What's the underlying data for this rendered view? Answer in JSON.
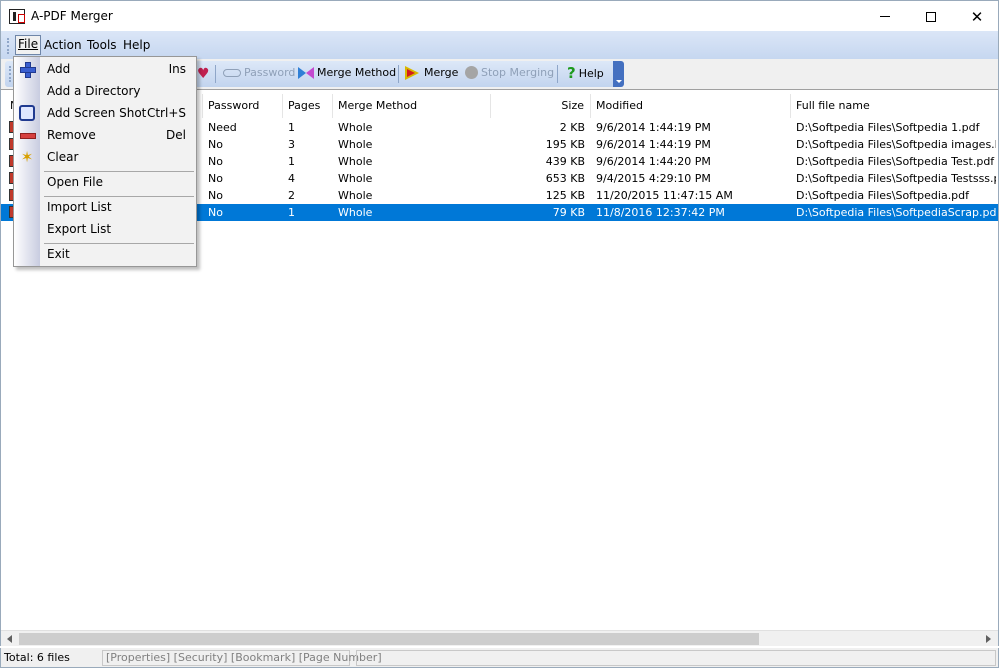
{
  "window": {
    "title": "A-PDF Merger"
  },
  "menu": {
    "items": [
      "File",
      "Action",
      "Tools",
      "Help"
    ]
  },
  "toolbar": {
    "password_label": "Password",
    "merge_method_label": "Merge Method",
    "merge_label": "Merge",
    "stop_merging_label": "Stop Merging",
    "help_label": "Help"
  },
  "file_menu": {
    "add": "Add",
    "add_shortcut": "Ins",
    "add_directory": "Add a Directory",
    "add_screenshot": "Add Screen Shot",
    "add_screenshot_shortcut": "Ctrl+S",
    "remove": "Remove",
    "remove_shortcut": "Del",
    "clear": "Clear",
    "open_file": "Open File",
    "import_list": "Import List",
    "export_list": "Export List",
    "exit": "Exit"
  },
  "list": {
    "columns": {
      "name": "N",
      "password": "Password",
      "pages": "Pages",
      "merge_method": "Merge Method",
      "size": "Size",
      "modified": "Modified",
      "full_name": "Full file name"
    },
    "rows": [
      {
        "password": "Need",
        "pages": "1",
        "method": "Whole",
        "size": "2 KB",
        "modified": "9/6/2014 1:44:19 PM",
        "path": "D:\\Softpedia Files\\Softpedia 1.pdf"
      },
      {
        "password": "No",
        "pages": "3",
        "method": "Whole",
        "size": "195 KB",
        "modified": "9/6/2014 1:44:19 PM",
        "path": "D:\\Softpedia Files\\Softpedia images.PDF"
      },
      {
        "password": "No",
        "pages": "1",
        "method": "Whole",
        "size": "439 KB",
        "modified": "9/6/2014 1:44:20 PM",
        "path": "D:\\Softpedia Files\\Softpedia Test.pdf"
      },
      {
        "password": "No",
        "pages": "4",
        "method": "Whole",
        "size": "653 KB",
        "modified": "9/4/2015 4:29:10 PM",
        "path": "D:\\Softpedia Files\\Softpedia Testsss.pdf"
      },
      {
        "password": "No",
        "pages": "2",
        "method": "Whole",
        "size": "125 KB",
        "modified": "11/20/2015 11:47:15 AM",
        "path": "D:\\Softpedia Files\\Softpedia.pdf"
      },
      {
        "password": "No",
        "pages": "1",
        "method": "Whole",
        "size": "79 KB",
        "modified": "11/8/2016 12:37:42 PM",
        "path": "D:\\Softpedia Files\\SoftpediaScrap.pdf"
      }
    ],
    "selected_index": 5
  },
  "status": {
    "total": "Total: 6 files",
    "links": "[Properties] [Security] [Bookmark] [Page Number]"
  }
}
